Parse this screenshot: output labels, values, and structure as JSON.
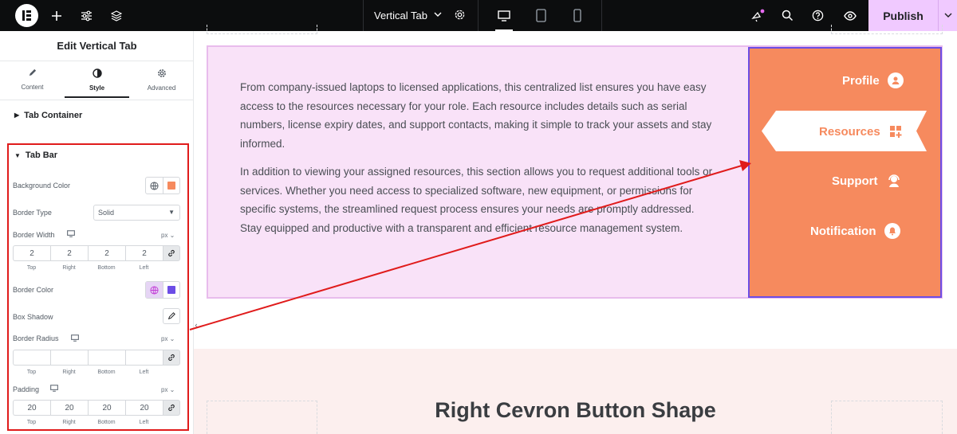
{
  "topbar": {
    "doc_title": "Vertical Tab",
    "publish_label": "Publish",
    "icons": [
      "elementor-logo-icon",
      "add-icon",
      "settings-sliders-icon",
      "layers-icon",
      "gear-icon",
      "desktop-icon",
      "tablet-icon",
      "mobile-icon",
      "whats-new-icon",
      "search-icon",
      "help-icon",
      "preview-eye-icon",
      "chevron-down-icon"
    ]
  },
  "panel": {
    "title": "Edit Vertical Tab",
    "tabs": [
      {
        "label": "Content",
        "icon": "pencil-icon"
      },
      {
        "label": "Style",
        "icon": "contrast-icon"
      },
      {
        "label": "Advanced",
        "icon": "gear-icon"
      }
    ],
    "active_tab": "Style",
    "sections": {
      "tab_container": "Tab Container",
      "tab_bar": "Tab Bar"
    },
    "controls": {
      "background_color_label": "Background Color",
      "background_color_value": "#f68a5e",
      "border_type_label": "Border Type",
      "border_type_value": "Solid",
      "border_width_label": "Border Width",
      "border_width_unit": "px",
      "border_width": {
        "top": "2",
        "right": "2",
        "bottom": "2",
        "left": "2"
      },
      "border_color_label": "Border Color",
      "border_color_value": "#6c4de6",
      "box_shadow_label": "Box Shadow",
      "border_radius_label": "Border Radius",
      "border_radius_unit": "px",
      "border_radius": {
        "top": "",
        "right": "",
        "bottom": "",
        "left": ""
      },
      "padding_label": "Padding",
      "padding_unit": "px",
      "padding": {
        "top": "20",
        "right": "20",
        "bottom": "20",
        "left": "20"
      },
      "dim_labels": {
        "top": "Top",
        "right": "Right",
        "bottom": "Bottom",
        "left": "Left"
      }
    }
  },
  "canvas": {
    "paragraphs": [
      "From company-issued laptops to licensed applications, this centralized list ensures you have easy access to the resources necessary for your role. Each resource includes details such as serial numbers, license expiry dates, and support contacts, making it simple to track your assets and stay informed.",
      "In addition to viewing your assigned resources, this section allows you to request additional tools or services. Whether you need access to specialized software, new equipment, or permissions for specific systems, the streamlined request process ensures your needs are promptly addressed. Stay equipped and productive with a transparent and efficient resource management system."
    ],
    "tabs": [
      {
        "label": "Profile",
        "icon": "user-circle-icon"
      },
      {
        "label": "Resources",
        "icon": "grid-plus-icon",
        "active": true
      },
      {
        "label": "Support",
        "icon": "support-agent-icon"
      },
      {
        "label": "Notification",
        "icon": "bell-icon"
      }
    ],
    "section_heading": "Right Cevron Button Shape"
  },
  "colors": {
    "accent": "#f68a5e",
    "tab_border": "#6c4de6",
    "widget_bg": "#f9e2f8",
    "annotation_red": "#e01b1b",
    "publish_bg": "#f0c9ff"
  }
}
